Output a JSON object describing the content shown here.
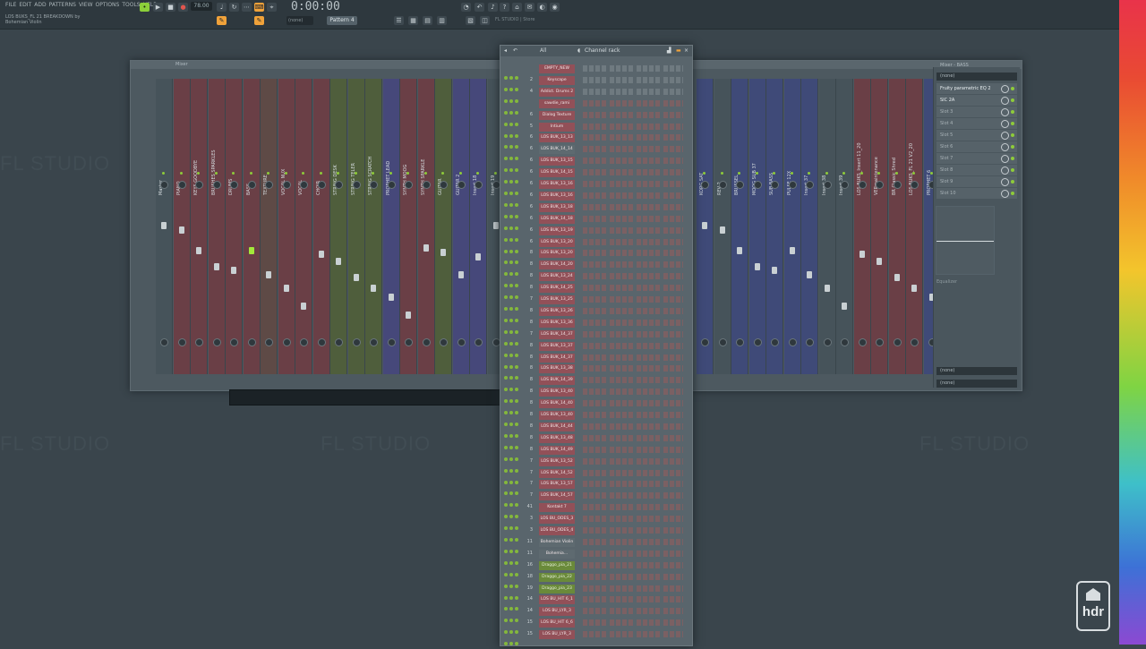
{
  "menu": [
    "FILE",
    "EDIT",
    "ADD",
    "PATTERNS",
    "VIEW",
    "OPTIONS",
    "TOOLS",
    "HELP"
  ],
  "song": {
    "line1": "LOS BUKS_FL 21 BREAKDOWN by",
    "line2": "Bohemian Violin"
  },
  "tempo": "78.00",
  "time": "0:00:00",
  "pattern": "Pattern 4",
  "pattern_none": "(none)",
  "hint": "FL STUDIO | Store",
  "watermarks": [
    "FL STUDIO",
    "FL STUDIO",
    "FL STUDIO",
    "FL STUDIO"
  ],
  "mixer": {
    "title": "Mixer",
    "tracks_left": [
      "Master",
      "PIANO",
      "KEYS GOODBYE",
      "BRUSHES SPARKLES",
      "DRUMS",
      "BASS",
      "TEXTURE",
      "VOCAL NUX",
      "VOCAL",
      "CHOIR",
      "STRING DESK",
      "STRING TELER",
      "STRING SCRATCH",
      "PROPHET LEAD",
      "SYNTH MOOG",
      "SYNTH SPARKLE",
      "GUITAR",
      "GUITAR 2",
      "Insert 18",
      "Insert 19"
    ],
    "tracks_right": [
      "KORG SAT",
      "REV 2",
      "BRUSSEL",
      "MOOG SUB 37",
      "SUB BASS",
      "PULSE 12X",
      "Insert 37",
      "Insert 38",
      "Insert 39",
      "LOS BUKS_Insert 11_20",
      "VERmaintenance",
      "BR Classic Shred",
      "LOS BUKS_FL 21 V2_20",
      "PROPHET 6"
    ],
    "fx_title": "Mixer - BASS",
    "fx_input": "(none)",
    "fx_slots": [
      "Fruity parametric EQ 2",
      "SIC 2A",
      "Slot 3",
      "Slot 4",
      "Slot 5",
      "Slot 6",
      "Slot 7",
      "Slot 8",
      "Slot 9",
      "Slot 10"
    ],
    "equalizer_label": "Equalizer",
    "fx_out1": "(none)",
    "fx_out2": "(none)"
  },
  "channel_rack": {
    "filter": "All",
    "title": "Channel rack",
    "channels": [
      {
        "num": "",
        "name": "EMPTY_NEW"
      },
      {
        "num": "2",
        "name": "Keyscape"
      },
      {
        "num": "4",
        "name": "Addict. Drums 2"
      },
      {
        "num": "",
        "name": "sawdie_rami"
      },
      {
        "num": "6",
        "name": "Dialog Texture"
      },
      {
        "num": "5",
        "name": "Intium"
      },
      {
        "num": "6",
        "name": "LOS BUK_13_13"
      },
      {
        "num": "6",
        "name": "LOS BUK_14_14"
      },
      {
        "num": "6",
        "name": "LOS BUK_13_15"
      },
      {
        "num": "6",
        "name": "LOS BUK_14_15"
      },
      {
        "num": "6",
        "name": "LOS BUK_13_16"
      },
      {
        "num": "6",
        "name": "LOS BUK_13_16"
      },
      {
        "num": "6",
        "name": "LOS BUK_13_18"
      },
      {
        "num": "6",
        "name": "LOS BUK_14_18"
      },
      {
        "num": "6",
        "name": "LOS BUK_13_19"
      },
      {
        "num": "6",
        "name": "LOS BUK_13_20"
      },
      {
        "num": "8",
        "name": "LOS BUK_13_20"
      },
      {
        "num": "8",
        "name": "LOS BUK_14_20"
      },
      {
        "num": "8",
        "name": "LOS BUK_13_24"
      },
      {
        "num": "8",
        "name": "LOS BUK_14_25"
      },
      {
        "num": "7",
        "name": "LOS BUK_13_25"
      },
      {
        "num": "8",
        "name": "LOS BUK_13_26"
      },
      {
        "num": "8",
        "name": "LOS BUK_13_36"
      },
      {
        "num": "7",
        "name": "LOS BUK_14_37"
      },
      {
        "num": "8",
        "name": "LOS BUK_13_37"
      },
      {
        "num": "8",
        "name": "LOS BUK_14_37"
      },
      {
        "num": "8",
        "name": "LOS BUK_13_38"
      },
      {
        "num": "8",
        "name": "LOS BUK_14_39"
      },
      {
        "num": "8",
        "name": "LOS BUK_13_40"
      },
      {
        "num": "8",
        "name": "LOS BUK_14_40"
      },
      {
        "num": "8",
        "name": "LOS BUK_13_40"
      },
      {
        "num": "8",
        "name": "LOS BUK_14_44"
      },
      {
        "num": "8",
        "name": "LOS BUK_13_48"
      },
      {
        "num": "8",
        "name": "LOS BUK_14_49"
      },
      {
        "num": "7",
        "name": "LOS BUK_13_52"
      },
      {
        "num": "7",
        "name": "LOS BUK_14_52"
      },
      {
        "num": "7",
        "name": "LOS BUK_13_57"
      },
      {
        "num": "7",
        "name": "LOS BUK_14_57"
      },
      {
        "num": "41",
        "name": "Kontakt 7"
      },
      {
        "num": "3",
        "name": "LOS BU_ODES_3"
      },
      {
        "num": "3",
        "name": "LOS BU_ODES_4"
      },
      {
        "num": "11",
        "name": "Bohemian Violin"
      },
      {
        "num": "11",
        "name": "Bohemia..."
      },
      {
        "num": "16",
        "name": "Draggo_pia_21"
      },
      {
        "num": "18",
        "name": "Draggo_pia_22"
      },
      {
        "num": "19",
        "name": "Draggo_pia_23"
      },
      {
        "num": "14",
        "name": "LOS BU_HIT 6_1"
      },
      {
        "num": "14",
        "name": "LOS BU_LYR_3"
      },
      {
        "num": "15",
        "name": "LOS BU_HIT 6_6"
      },
      {
        "num": "15",
        "name": "LOS BU_LYR_3"
      }
    ]
  },
  "hdr_logo": "hdr"
}
